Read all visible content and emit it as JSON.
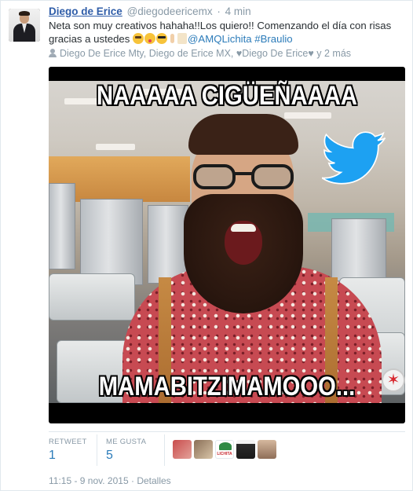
{
  "tweet": {
    "name": "Diego de Erice",
    "screen_name": "@diegodeericemx",
    "separator": "·",
    "time_ago": "4 min",
    "text_part1": "Neta son muy creativos hahaha!!Los quiero!! Comenzando el día con risas gracias a ustedes ",
    "mention": "@AMQLichita",
    "hashtag": "#Braulio",
    "emojis": [
      "joy-emoji",
      "kiss-emoji",
      "sunglasses-emoji",
      "victory-hand-emoji",
      "clapping-hands-emoji"
    ],
    "mentioned_users": "Diego De Erice Mty, Diego de Erice MX, ",
    "mentioned_heart_user": "Diego De Erice",
    "mentioned_more": " y 2 más"
  },
  "media": {
    "top_caption": "NAAAAA CIGÜEÑAAAA",
    "bottom_caption": "MAMABITZIMAMOOO...",
    "overlay_icons": [
      "twitter-bird-icon",
      "star-badge-icon"
    ]
  },
  "stats": {
    "retweet_label": "RETWEET",
    "retweet_count": "1",
    "like_label": "ME GUSTA",
    "like_count": "5"
  },
  "footer": {
    "timestamp": "11:15 - 9 nov. 2015",
    "separator": "·",
    "details_link": "Detalles"
  },
  "colors": {
    "link": "#2b7bb9",
    "name": "#2f5da8",
    "muted": "#8899a6",
    "twitter_blue": "#1da1f2"
  }
}
